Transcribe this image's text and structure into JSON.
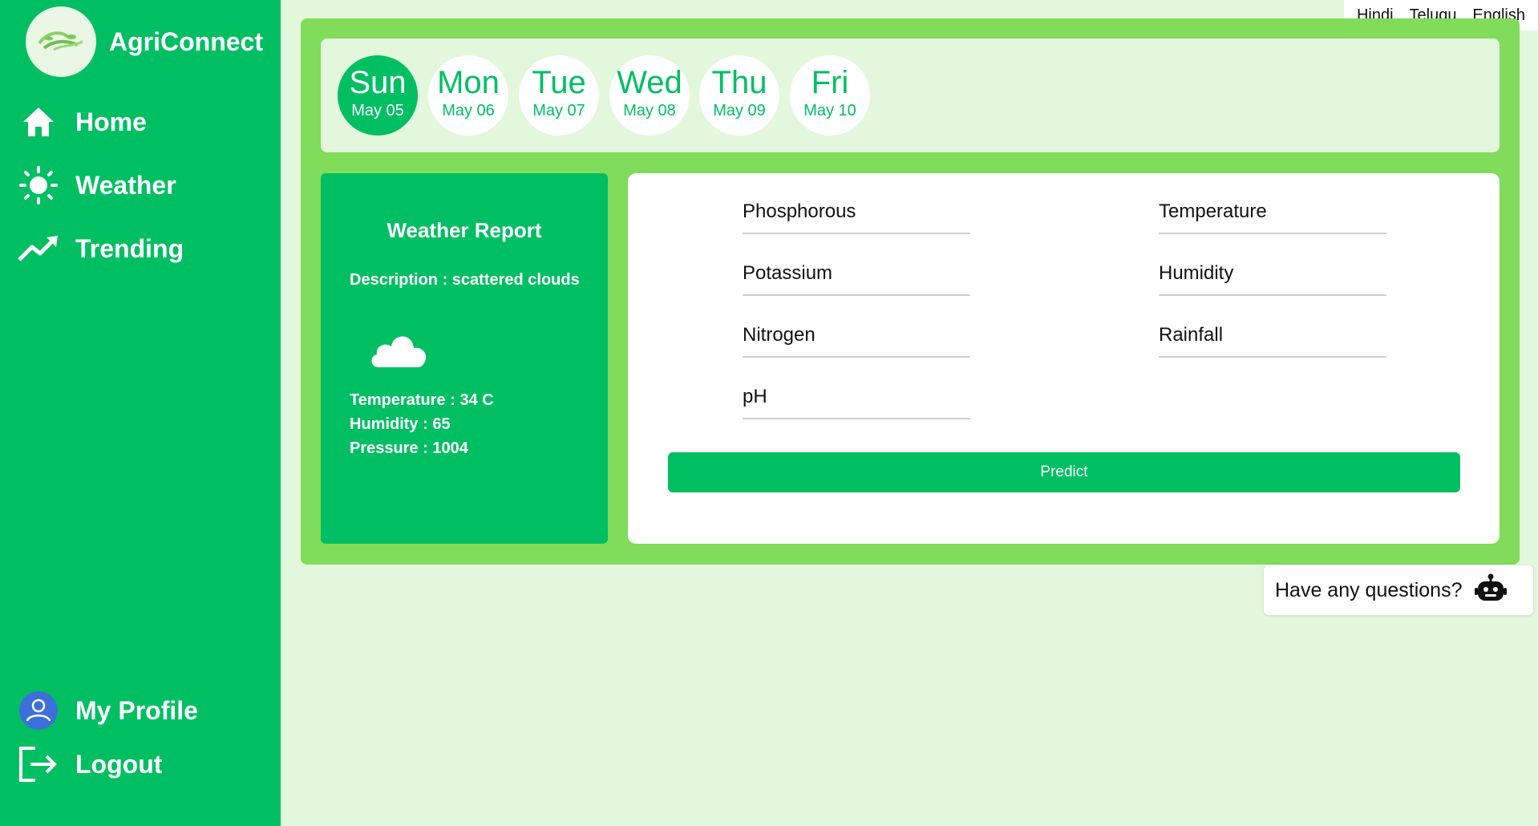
{
  "brand": {
    "name": "AgriConnect"
  },
  "nav": {
    "home": "Home",
    "weather": "Weather",
    "trending": "Trending",
    "profile": "My Profile",
    "logout": "Logout"
  },
  "languages": [
    "Hindi",
    "Telugu",
    "English"
  ],
  "days": [
    {
      "name": "Sun",
      "date": "May 05",
      "active": true
    },
    {
      "name": "Mon",
      "date": "May 06"
    },
    {
      "name": "Tue",
      "date": "May 07"
    },
    {
      "name": "Wed",
      "date": "May 08"
    },
    {
      "name": "Thu",
      "date": "May 09"
    },
    {
      "name": "Fri",
      "date": "May 10"
    }
  ],
  "weather_report": {
    "title": "Weather Report",
    "description": "Description : scattered clouds",
    "icon": "cloud-icon",
    "temperature": "Temperature : 34 C",
    "humidity": "Humidity : 65",
    "pressure": "Pressure : 1004"
  },
  "form": {
    "phosphorous": "Phosphorous",
    "potassium": "Potassium",
    "nitrogen": "Nitrogen",
    "ph": "pH",
    "temperature": "Temperature",
    "humidity": "Humidity",
    "rainfall": "Rainfall",
    "predict": "Predict"
  },
  "chat": {
    "prompt": "Have any questions?",
    "icon": "robot-icon"
  },
  "colors": {
    "primary": "#00bf63",
    "panel": "#80dc5a",
    "background": "#e3f7dc",
    "profile_avatar": "#3d6fd8"
  }
}
